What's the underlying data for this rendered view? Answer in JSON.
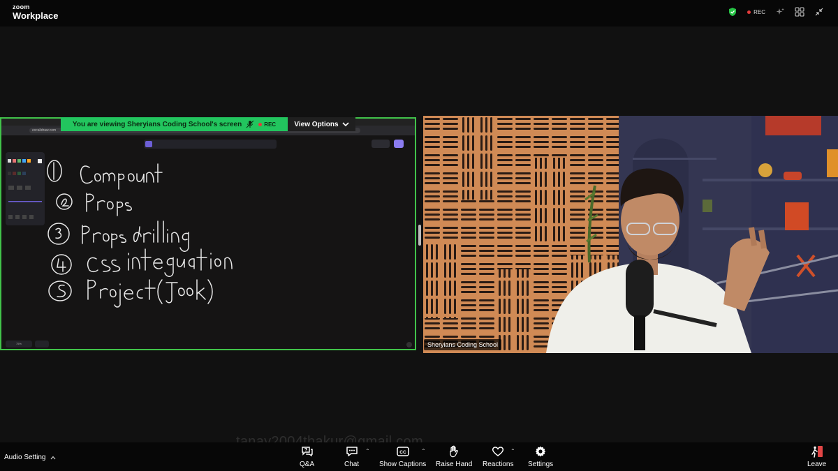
{
  "app": {
    "brand_top": "zoom",
    "brand_bottom": "Workplace"
  },
  "topbar": {
    "rec_label": "REC"
  },
  "share": {
    "banner_text": "You are viewing  Sheryians Coding School's screen",
    "banner_rec": "REC",
    "view_options_label": "View Options",
    "url_text": "excalidraw.com",
    "zoom_level": "75%"
  },
  "video": {
    "participant_name": "Sheryians Coding School"
  },
  "watermark": "tanay2004thakur@gmail.com",
  "bottombar": {
    "audio_setting": "Audio Setting",
    "items": [
      {
        "label": "Q&A"
      },
      {
        "label": "Chat"
      },
      {
        "label": "Show Captions"
      },
      {
        "label": "Raise Hand"
      },
      {
        "label": "Reactions"
      },
      {
        "label": "Settings"
      }
    ],
    "leave": "Leave"
  },
  "colors": {
    "share_border": "#41c34a",
    "banner": "#22c55e",
    "rec_red": "#e43b3b",
    "shield": "#27c346"
  }
}
